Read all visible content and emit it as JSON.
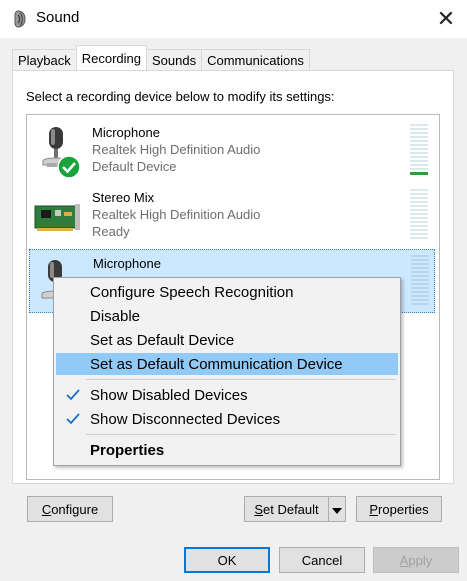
{
  "window": {
    "title": "Sound",
    "icon": "speaker-icon",
    "close_glyph": "✕"
  },
  "tabs": [
    {
      "label": "Playback",
      "active": false
    },
    {
      "label": "Recording",
      "active": true
    },
    {
      "label": "Sounds",
      "active": false
    },
    {
      "label": "Communications",
      "active": false
    }
  ],
  "instruction": "Select a recording device below to modify its settings:",
  "devices": [
    {
      "name": "Microphone",
      "driver": "Realtek High Definition Audio",
      "status": "Default Device",
      "icon": "microphone-icon",
      "badge": "default-check-icon",
      "level": 0.15
    },
    {
      "name": "Stereo Mix",
      "driver": "Realtek High Definition Audio",
      "status": "Ready",
      "icon": "sound-card-icon",
      "level": 0
    },
    {
      "name": "Microphone",
      "driver": "",
      "status": "",
      "icon": "microphone-icon",
      "selected": true
    }
  ],
  "context_menu": {
    "items": [
      {
        "label": "Configure Speech Recognition"
      },
      {
        "label": "Disable"
      },
      {
        "label": "Set as Default Device"
      },
      {
        "label": "Set as Default Communication Device",
        "highlighted": true
      },
      {
        "label": "Show Disabled Devices",
        "checked": true
      },
      {
        "label": "Show Disconnected Devices",
        "checked": true
      },
      {
        "label": "Properties",
        "bold": true
      }
    ]
  },
  "buttons": {
    "configure": {
      "label": "Configure",
      "mnemonic": "C",
      "rest": "onfigure"
    },
    "set_default": {
      "label": "Set Default",
      "mnemonic": "S",
      "rest": "et Default"
    },
    "properties": {
      "label": "Properties",
      "mnemonic": "P",
      "rest": "roperties"
    },
    "ok": "OK",
    "cancel": "Cancel",
    "apply": {
      "label": "Apply",
      "mnemonic": "A",
      "rest": "pply"
    }
  },
  "colors": {
    "accent": "#0078d7",
    "selection": "#cce8ff",
    "menu_highlight": "#91c9f7",
    "check_green": "#1aa33b",
    "meter_active": "#2e9d3a"
  }
}
